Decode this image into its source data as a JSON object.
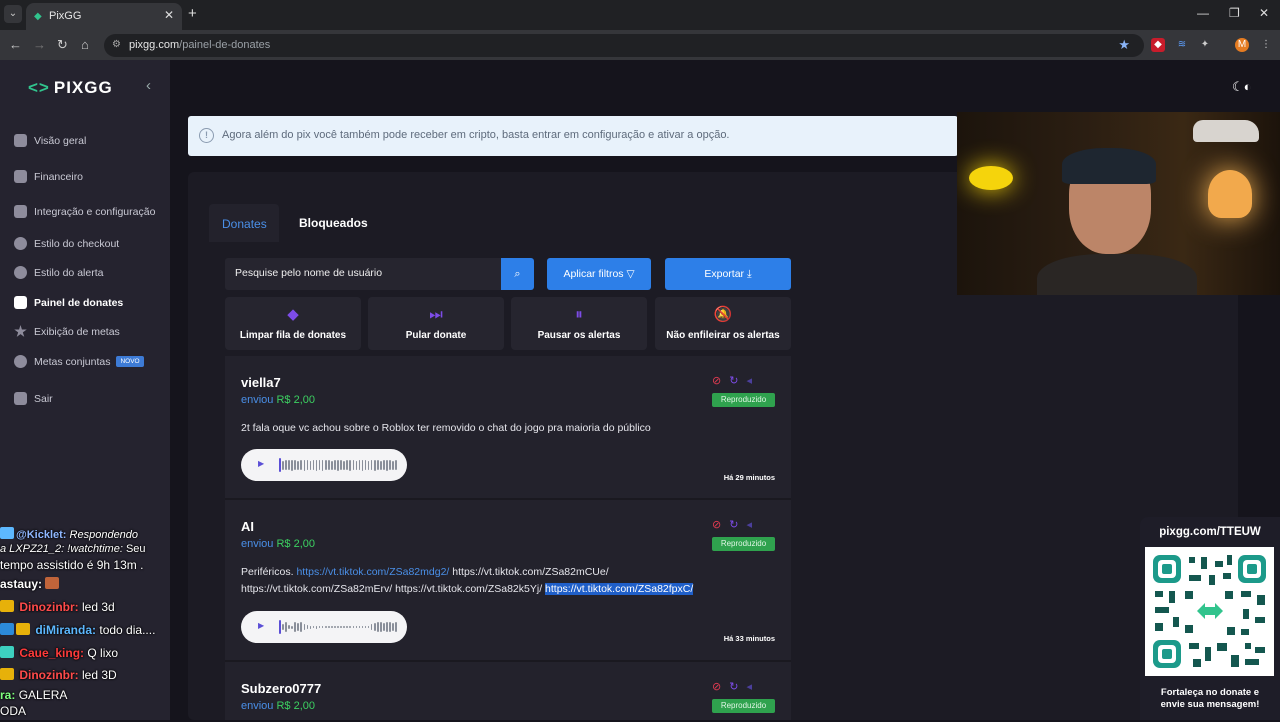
{
  "browser": {
    "tab_title": "PixGG",
    "url_host": "pixgg.com",
    "url_path": "/painel-de-donates"
  },
  "sidebar": {
    "logo": "PIXGG",
    "items": [
      {
        "label": "Visão geral"
      },
      {
        "label": "Financeiro"
      },
      {
        "label": "Integração e configuração"
      },
      {
        "label": "Estilo do checkout"
      },
      {
        "label": "Estilo do alerta"
      },
      {
        "label": "Painel de donates"
      },
      {
        "label": "Exibição de metas"
      },
      {
        "label": "Metas conjuntas",
        "badge": "NOVO"
      },
      {
        "label": "Sair"
      }
    ]
  },
  "banner": {
    "text": "Agora além do pix você também pode receber em cripto, basta entrar em configuração e ativar a opção."
  },
  "tabs": {
    "donates": "Donates",
    "bloqueados": "Bloqueados"
  },
  "toolbar": {
    "search_placeholder": "Pesquise pelo nome de usuário",
    "apply_filters": "Aplicar filtros",
    "export": "Exportar"
  },
  "actions": [
    {
      "label": "Limpar fila de donates",
      "icon": "eraser-icon"
    },
    {
      "label": "Pular donate",
      "icon": "skip-icon"
    },
    {
      "label": "Pausar os alertas",
      "icon": "pause-icon"
    },
    {
      "label": "Não enfileirar os alertas",
      "icon": "bell-off-icon"
    }
  ],
  "donates": [
    {
      "username": "viella7",
      "sent_label": "enviou",
      "amount": "R$ 2,00",
      "message": "2t fala oque vc achou sobre o Roblox ter removido o chat do jogo pra maioria do público",
      "status": "Reproduzido",
      "time": "Há 29 minutos"
    },
    {
      "username": "AI",
      "sent_label": "enviou",
      "amount": "R$ 2,00",
      "message_prefix": "Periféricos.",
      "link1": "https://vt.tiktok.com/ZSa82mdg2/",
      "text1": "https://vt.tiktok.com/ZSa82mCUe/",
      "text2": "https://vt.tiktok.com/ZSa82mErv/",
      "text3": "https://vt.tiktok.com/ZSa82k5Yj/",
      "link_selected": "https://vt.tiktok.com/ZSa82fpxC/",
      "status": "Reproduzido",
      "time": "Há 33 minutos"
    },
    {
      "username": "Subzero0777",
      "sent_label": "enviou",
      "amount": "R$ 2,00",
      "status": "Reproduzido"
    }
  ],
  "chat": [
    {
      "user": "@Kicklet:",
      "text": "Respondendo",
      "color": "#8fb7ff"
    },
    {
      "user": "a LXPZ21_2: !watchtime:",
      "text": "Seu",
      "color": "#ffffff"
    },
    {
      "user": "",
      "text": "tempo assistido é 9h 13m .",
      "color": "#ffffff"
    },
    {
      "user": "astauy:",
      "text": "",
      "color": "#ffffff"
    },
    {
      "user": "Dinozinbr:",
      "text": "led 3d",
      "color": "#ff4b4b"
    },
    {
      "user": "diMiranda:",
      "text": "todo dia....",
      "color": "#5db8ff"
    },
    {
      "user": "Caue_king:",
      "text": "Q lixo",
      "color": "#ff3b3b"
    },
    {
      "user": "Dinozinbr:",
      "text": "led 3D",
      "color": "#ff4b4b"
    },
    {
      "user": "ra:",
      "text": "GALERA",
      "color": "#7fff7f"
    },
    {
      "user": "",
      "text": "ODA",
      "color": "#ffffff"
    }
  ],
  "qr": {
    "title": "pixgg.com/TTEUW",
    "footer_line1": "Fortaleça no donate e",
    "footer_line2": "envie sua mensagem!"
  },
  "colors": {
    "accent_blue": "#2d7fe8",
    "brand_green": "#31c48d",
    "amount_green": "#3cd061",
    "status_green": "#2fa24e"
  }
}
